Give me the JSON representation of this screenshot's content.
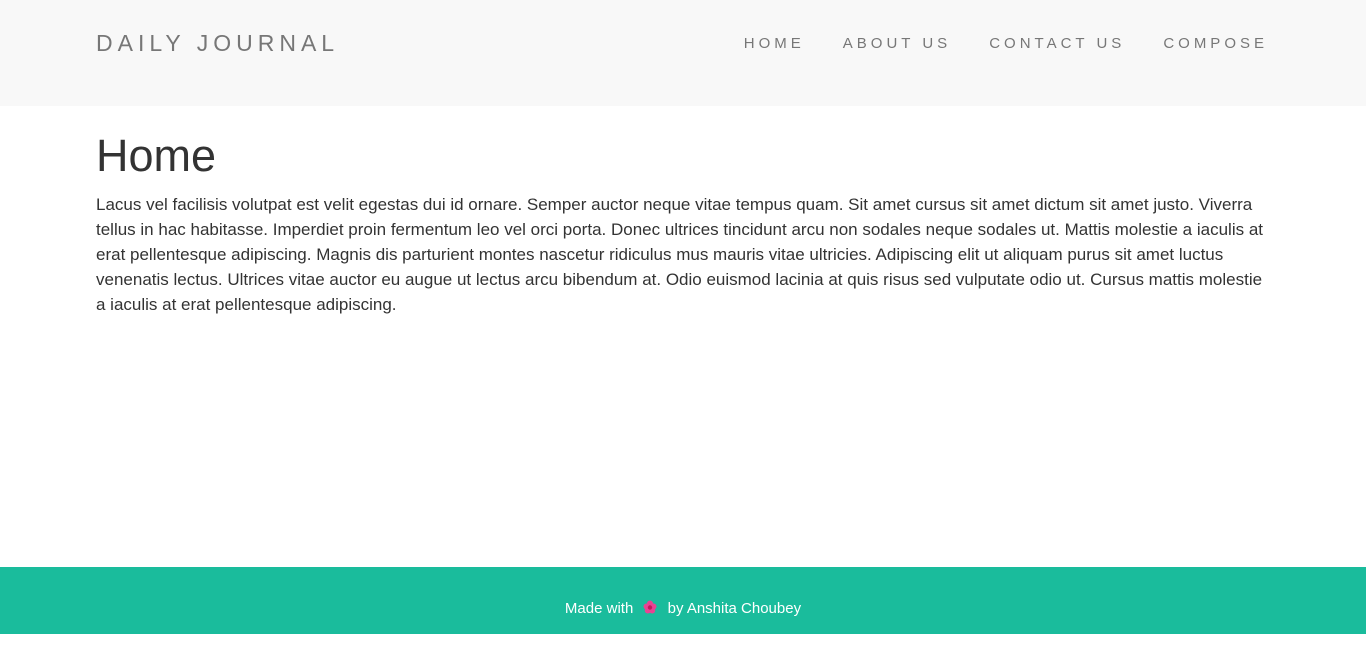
{
  "navbar": {
    "brand": "DAILY JOURNAL",
    "links": [
      {
        "label": "HOME"
      },
      {
        "label": "ABOUT US"
      },
      {
        "label": "CONTACT US"
      },
      {
        "label": "COMPOSE"
      }
    ]
  },
  "main": {
    "title": "Home",
    "body": "Lacus vel facilisis volutpat est velit egestas dui id ornare. Semper auctor neque vitae tempus quam. Sit amet cursus sit amet dictum sit amet justo. Viverra tellus in hac habitasse. Imperdiet proin fermentum leo vel orci porta. Donec ultrices tincidunt arcu non sodales neque sodales ut. Mattis molestie a iaculis at erat pellentesque adipiscing. Magnis dis parturient montes nascetur ridiculus mus mauris vitae ultricies. Adipiscing elit ut aliquam purus sit amet luctus venenatis lectus. Ultrices vitae auctor eu augue ut lectus arcu bibendum at. Odio euismod lacinia at quis risus sed vulputate odio ut. Cursus mattis molestie a iaculis at erat pellentesque adipiscing."
  },
  "footer": {
    "prefix": "Made with",
    "icon": "flower-icon",
    "suffix": "by Anshita Choubey"
  },
  "colors": {
    "navbar_bg": "#f8f8f8",
    "footer_bg": "#1abc9c",
    "text": "#333333",
    "nav_text": "#777777"
  }
}
